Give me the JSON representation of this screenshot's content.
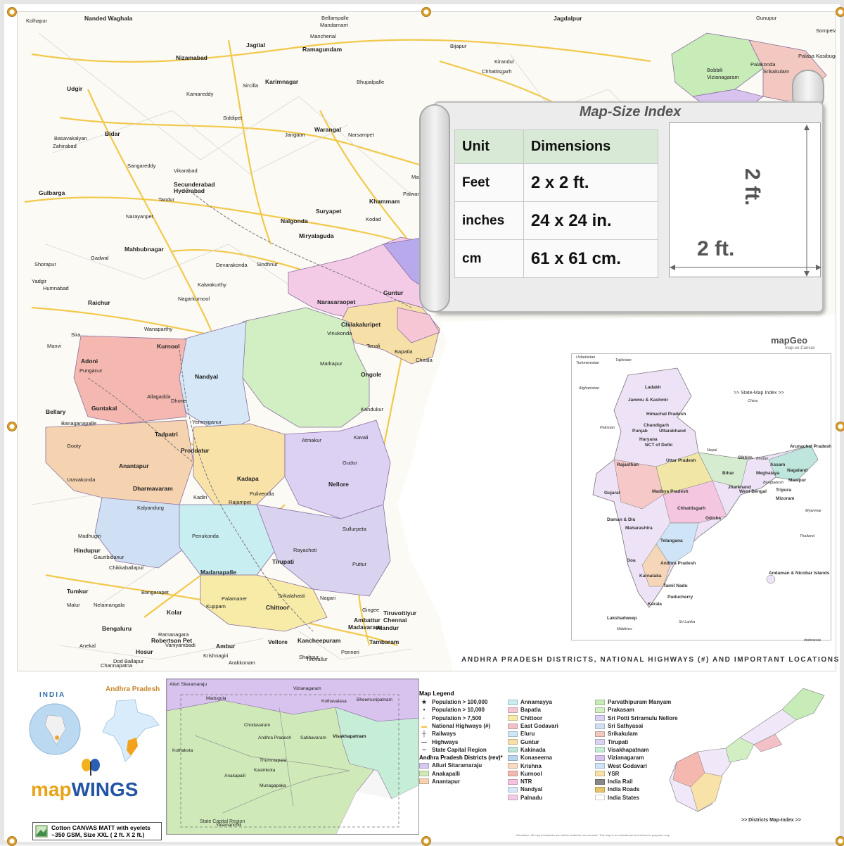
{
  "colors": {
    "road": "#f2c94c",
    "highway": "#e0b030",
    "railway": "#777777",
    "canvas_bg": "#fbfaf4",
    "legend_header": "#d8ead5"
  },
  "size_index": {
    "title": "Map-Size Index",
    "header": [
      "Unit",
      "Dimensions"
    ],
    "rows": [
      {
        "unit": "Feet",
        "dim": "2 x 2 ft."
      },
      {
        "unit": "inches",
        "dim": "24 x 24 in."
      },
      {
        "unit": "cm",
        "dim": "61 x 61 cm."
      }
    ],
    "height_label": "2 ft.",
    "width_label": "2 ft."
  },
  "map_title": "ANDHRA PRADESH DISTRICTS, NATIONAL HIGHWAYS (#) AND IMPORTANT LOCATIONS",
  "places": [
    {
      "name": "Nanded Waghala",
      "big": true
    },
    {
      "name": "Nizamabad",
      "big": true
    },
    {
      "name": "Jagtial",
      "big": true
    },
    {
      "name": "Ramagundam",
      "big": true
    },
    {
      "name": "Karimnagar",
      "big": true
    },
    {
      "name": "Udgir",
      "big": true
    },
    {
      "name": "Bidar",
      "big": true
    },
    {
      "name": "Warangal",
      "big": true
    },
    {
      "name": "Gulbarga",
      "big": true
    },
    {
      "name": "Secunderabad",
      "big": true
    },
    {
      "name": "Hyderabad",
      "big": true
    },
    {
      "name": "Suryapet",
      "big": true
    },
    {
      "name": "Khammam",
      "big": true
    },
    {
      "name": "Nalgonda",
      "big": true
    },
    {
      "name": "Miryalaguda",
      "big": true
    },
    {
      "name": "Mahbubnagar",
      "big": true
    },
    {
      "name": "Raichur",
      "big": true
    },
    {
      "name": "Guntur",
      "big": true
    },
    {
      "name": "Narasaraopet",
      "big": true
    },
    {
      "name": "Chilakaluripet",
      "big": true
    },
    {
      "name": "Machilipatnam",
      "big": true
    },
    {
      "name": "Kurnool",
      "big": true
    },
    {
      "name": "Adoni",
      "big": true
    },
    {
      "name": "Nandyal",
      "big": true
    },
    {
      "name": "Ongole",
      "big": true
    },
    {
      "name": "Guntakal",
      "big": true
    },
    {
      "name": "Bellary",
      "big": true
    },
    {
      "name": "Tadpatri",
      "big": true
    },
    {
      "name": "Proddatur",
      "big": true
    },
    {
      "name": "Anantapur",
      "big": true
    },
    {
      "name": "Kadapa",
      "big": true
    },
    {
      "name": "Nellore",
      "big": true
    },
    {
      "name": "Dharmavaram",
      "big": true
    },
    {
      "name": "Hindupur",
      "big": true
    },
    {
      "name": "Tirupati",
      "big": true
    },
    {
      "name": "Madanapalle",
      "big": true
    },
    {
      "name": "Tumkur",
      "big": true
    },
    {
      "name": "Kolar",
      "big": true
    },
    {
      "name": "Chittoor",
      "big": true
    },
    {
      "name": "Bengaluru",
      "big": true
    },
    {
      "name": "Robertson Pet",
      "big": true
    },
    {
      "name": "Hosur",
      "big": true
    },
    {
      "name": "Ambur",
      "big": true
    },
    {
      "name": "Vellore",
      "big": true
    },
    {
      "name": "Kancheepuram",
      "big": true
    },
    {
      "name": "Tambaram",
      "big": true
    },
    {
      "name": "Chennai",
      "big": true
    },
    {
      "name": "Tiruvottiyur",
      "big": true
    },
    {
      "name": "Ambattur",
      "big": true
    },
    {
      "name": "Madavaram",
      "big": true
    },
    {
      "name": "Alandur",
      "big": true
    },
    {
      "name": "Jagdalpur",
      "big": true
    },
    {
      "name": "Kolhapur",
      "big": false
    },
    {
      "name": "Mancherial",
      "big": false
    },
    {
      "name": "Bellampalle",
      "big": false
    },
    {
      "name": "Mandamarri",
      "big": false
    },
    {
      "name": "Bhupalpalle",
      "big": false
    },
    {
      "name": "Bijapur",
      "big": false
    },
    {
      "name": "Chhattisgarh",
      "big": false
    },
    {
      "name": "Kirandul",
      "big": false
    },
    {
      "name": "Gunupur",
      "big": false
    },
    {
      "name": "Sompeta",
      "big": false
    },
    {
      "name": "Palasa Kasibugga",
      "big": false
    },
    {
      "name": "Bobbili",
      "big": false
    },
    {
      "name": "Palakonda",
      "big": false
    },
    {
      "name": "Srikakulam",
      "big": false
    },
    {
      "name": "Vizianagaram",
      "big": false
    },
    {
      "name": "Siddipet",
      "big": false
    },
    {
      "name": "Sircilla",
      "big": false
    },
    {
      "name": "Kamareddy",
      "big": false
    },
    {
      "name": "Narsampet",
      "big": false
    },
    {
      "name": "Jangaon",
      "big": false
    },
    {
      "name": "Mahabubabad",
      "big": false
    },
    {
      "name": "Palwancha",
      "big": false
    },
    {
      "name": "Kodad",
      "big": false
    },
    {
      "name": "Vinukonda",
      "big": false
    },
    {
      "name": "Chirala",
      "big": false
    },
    {
      "name": "Bapatla",
      "big": false
    },
    {
      "name": "Tenali",
      "big": false
    },
    {
      "name": "Markapur",
      "big": false
    },
    {
      "name": "Kandukur",
      "big": false
    },
    {
      "name": "Kavali",
      "big": false
    },
    {
      "name": "Atmakur",
      "big": false
    },
    {
      "name": "Gudur",
      "big": false
    },
    {
      "name": "Sullurpeta",
      "big": false
    },
    {
      "name": "Puttur",
      "big": false
    },
    {
      "name": "Nagari",
      "big": false
    },
    {
      "name": "Srikalahasti",
      "big": false
    },
    {
      "name": "Rayachoti",
      "big": false
    },
    {
      "name": "Rajampet",
      "big": false
    },
    {
      "name": "Pulivendla",
      "big": false
    },
    {
      "name": "Kadiri",
      "big": false
    },
    {
      "name": "Penukonda",
      "big": false
    },
    {
      "name": "Kalyandurg",
      "big": false
    },
    {
      "name": "Uravakonda",
      "big": false
    },
    {
      "name": "Gooty",
      "big": false
    },
    {
      "name": "Banaganapalle",
      "big": false
    },
    {
      "name": "Dhone",
      "big": false
    },
    {
      "name": "Allagadda",
      "big": false
    },
    {
      "name": "Yemmiganur",
      "big": false
    },
    {
      "name": "Punganur",
      "big": false
    },
    {
      "name": "Palamaner",
      "big": false
    },
    {
      "name": "Kuppam",
      "big": false
    },
    {
      "name": "Krishnagiri",
      "big": false
    },
    {
      "name": "Vaniyambadi",
      "big": false
    },
    {
      "name": "Arakkonam",
      "big": false
    },
    {
      "name": "Tiruvallur",
      "big": false
    },
    {
      "name": "Ponneri",
      "big": false
    },
    {
      "name": "Gingee",
      "big": false
    },
    {
      "name": "Shahpur",
      "big": false
    },
    {
      "name": "Shorapur",
      "big": false
    },
    {
      "name": "Yadgir",
      "big": false
    },
    {
      "name": "Humnabad",
      "big": false
    },
    {
      "name": "Basavakalyan",
      "big": false
    },
    {
      "name": "Zahirabad",
      "big": false
    },
    {
      "name": "Sangareddy",
      "big": false
    },
    {
      "name": "Vikarabad",
      "big": false
    },
    {
      "name": "Tandur",
      "big": false
    },
    {
      "name": "Narayanpet",
      "big": false
    },
    {
      "name": "Gadwal",
      "big": false
    },
    {
      "name": "Wanaparthy",
      "big": false
    },
    {
      "name": "Nagarkurnool",
      "big": false
    },
    {
      "name": "Kalwakurthy",
      "big": false
    },
    {
      "name": "Devarakonda",
      "big": false
    },
    {
      "name": "Sindhnur",
      "big": false
    },
    {
      "name": "Manvi",
      "big": false
    },
    {
      "name": "Sira",
      "big": false
    },
    {
      "name": "Madhugiri",
      "big": false
    },
    {
      "name": "Gauribidanur",
      "big": false
    },
    {
      "name": "Chikkaballapur",
      "big": false
    },
    {
      "name": "Malur",
      "big": false
    },
    {
      "name": "Bangarapet",
      "big": false
    },
    {
      "name": "Ramanagara",
      "big": false
    },
    {
      "name": "Anekal",
      "big": false
    },
    {
      "name": "Channapatna",
      "big": false
    },
    {
      "name": "Dod Ballapur",
      "big": false
    },
    {
      "name": "Nelamangala",
      "big": false
    }
  ],
  "mapgeo": {
    "logo": "mapGeo",
    "sub": "map-on-Canvas"
  },
  "india_inset": {
    "index_label": ">> State-Map Index >>",
    "states": [
      "Ladakh",
      "Jammu & Kashmir",
      "Himachal Pradesh",
      "Punjab",
      "Chandigarh",
      "Uttarakhand",
      "Haryana",
      "NCT of Delhi",
      "Rajasthan",
      "Uttar Pradesh",
      "Sikkim",
      "Arunachal Pradesh",
      "Assam",
      "Nagaland",
      "Meghalaya",
      "Manipur",
      "Tripura",
      "Mizoram",
      "Bihar",
      "Jharkhand",
      "West Bengal",
      "Gujarat",
      "Madhya Pradesh",
      "Chhattisgarh",
      "Odisha",
      "Daman & Diu",
      "Maharashtra",
      "Telangana",
      "Goa",
      "Andhra Pradesh",
      "Karnataka",
      "Tamil Nadu",
      "Puducherry",
      "Kerala",
      "Lakshadweep",
      "Andaman & Nicobar Islands"
    ],
    "neighbours": [
      "Uzbekistan",
      "Turkmenistan",
      "Tajikistan",
      "Afghanistan",
      "Pakistan",
      "China",
      "Nepal",
      "Bhutan",
      "Bangladesh",
      "Myanmar",
      "Thailand",
      "Sri Lanka",
      "Maldives",
      "Indonesia"
    ]
  },
  "bottom": {
    "india_label": "INDIA",
    "ap_label": "Andhra Pradesh",
    "logo_a": "map",
    "logo_b": "WINGS",
    "canvas_note_line1": "Cotton CANVAS MATT with eyelets",
    "canvas_note_line2": "~350 GSM, Size XXL ( 2 ft. X 2 ft.)",
    "capital_places": [
      "Alluri Sitaramaraju",
      "Vizianagaram",
      "Madugula",
      "Kothavalasa",
      "Bheemunipatnam",
      "Chodavaram",
      "Andhra Pradesh",
      "Kothakota",
      "Sabbavaram",
      "Visakhapatnam",
      "Anakapalli",
      "Thummapala",
      "Kasimkota",
      "Munagapaka",
      "Yelamanchili"
    ],
    "capital_label": "State Capital Region",
    "legend_title": "Map Legend",
    "legend_symbols": [
      {
        "sym": "★",
        "label": "Population > 100,000"
      },
      {
        "sym": "•",
        "label": "Population > 10,000"
      },
      {
        "sym": "·",
        "label": "Population > 7,500"
      },
      {
        "sym": "▬",
        "label": "National Highways (#)"
      },
      {
        "sym": "┼",
        "label": "Railways"
      },
      {
        "sym": "—",
        "label": "Highways"
      },
      {
        "sym": "┈",
        "label": "State Capital Region"
      }
    ],
    "legend_districts_heading": "Andhra Pradesh Districts (rev)*",
    "districts": [
      {
        "name": "Alluri Sitaramaraju",
        "color": "#d6c9f0"
      },
      {
        "name": "Anakapalli",
        "color": "#cfe9b8"
      },
      {
        "name": "Anantapur",
        "color": "#f6d3b0"
      },
      {
        "name": "Annamayya",
        "color": "#c9eef2"
      },
      {
        "name": "Bapatla",
        "color": "#f6c6d5"
      },
      {
        "name": "Chittoor",
        "color": "#f8eba8"
      },
      {
        "name": "East Godavari",
        "color": "#f3c0c8"
      },
      {
        "name": "Eluru",
        "color": "#cfe6f5"
      },
      {
        "name": "Guntur",
        "color": "#f7e0a8"
      },
      {
        "name": "Kakinada",
        "color": "#bfe4d9"
      },
      {
        "name": "Konaseema",
        "color": "#b8d6f0"
      },
      {
        "name": "Krishna",
        "color": "#f9d9c0"
      },
      {
        "name": "Kurnool",
        "color": "#f5b8b0"
      },
      {
        "name": "NTR",
        "color": "#f7c2de"
      },
      {
        "name": "Nandyal",
        "color": "#d6e7f7"
      },
      {
        "name": "Palnadu",
        "color": "#f4cbe6"
      },
      {
        "name": "Parvathipuram Manyam",
        "color": "#c8ecb8"
      },
      {
        "name": "Prakasam",
        "color": "#d2efc3"
      },
      {
        "name": "Sri Potti Sriramulu Nellore",
        "color": "#dcd0f3"
      },
      {
        "name": "Sri Sathyasai",
        "color": "#cfe0f5"
      },
      {
        "name": "Srikakulam",
        "color": "#f2c8c0"
      },
      {
        "name": "Tirupati",
        "color": "#dad3f0"
      },
      {
        "name": "Visakhapatnam",
        "color": "#c6edd6"
      },
      {
        "name": "Vizianagaram",
        "color": "#d8c3ef"
      },
      {
        "name": "West Godavari",
        "color": "#cfe5f7"
      },
      {
        "name": "YSR",
        "color": "#f9e2a8"
      },
      {
        "name": "India Rail",
        "color": "#888888"
      },
      {
        "name": "India Roads",
        "color": "#e6c46a"
      },
      {
        "name": "India States",
        "color": "#ffffff"
      }
    ],
    "districts_index_label": ">> Districts Map-Index >>",
    "disclaimer": "Disclaimer: All map boundaries are neither authentic nor accurate. This map is for educational and reference purposes only."
  }
}
